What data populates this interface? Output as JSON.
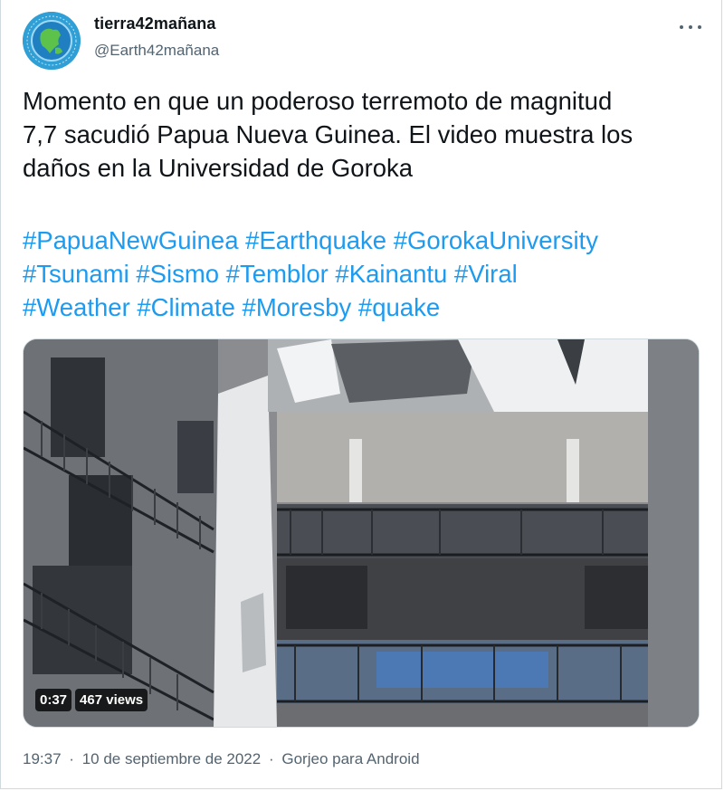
{
  "author": {
    "name": "tierra42mañana",
    "handle": "@Earth42mañana",
    "avatar_icon": "earth-globe-icon"
  },
  "more_icon": "more-options-icon",
  "tweet": {
    "text_lines": [
      "Momento en que un poderoso terremoto de magnitud",
      "7,7 sacudió Papua Nueva Guinea. El video muestra los",
      "daños en la Universidad de Goroka"
    ],
    "hashtag_rows": [
      [
        " #PapuaNewGuinea",
        " #Earthquake",
        " #GorokaUniversity"
      ],
      [
        "#Tsunami",
        " #Sismo",
        " #Temblor",
        " #Kainantu",
        " #Viral"
      ],
      [
        "#Weather",
        " #Climate",
        " #Moresby",
        " #quake"
      ]
    ]
  },
  "media": {
    "duration": "0:37",
    "views": "467 views"
  },
  "meta": {
    "time": "19:37",
    "separator": "·",
    "date": "10 de septiembre de 2022",
    "source": "Gorjeo para Android"
  },
  "colors": {
    "link": "#1d9bf0",
    "secondary_text": "#536471",
    "primary_text": "#0f1419"
  }
}
